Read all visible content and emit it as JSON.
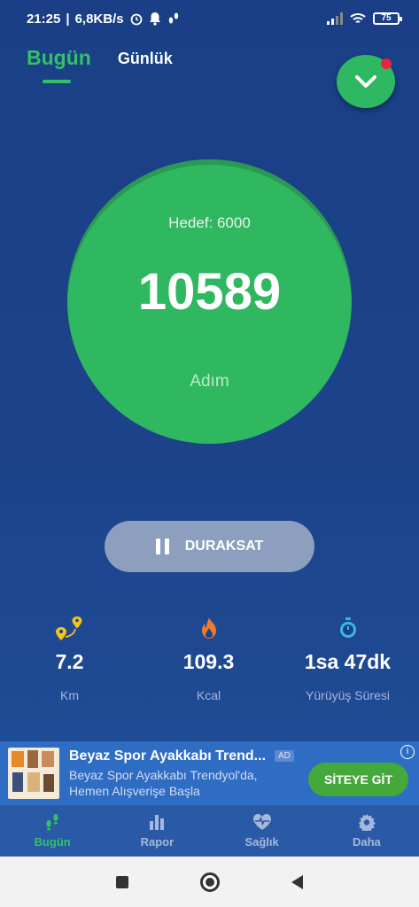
{
  "status": {
    "time": "21:25",
    "network_speed": "6,8KB/s",
    "battery": "75"
  },
  "tabs": [
    {
      "label": "Bugün",
      "active": true
    },
    {
      "label": "Günlük",
      "active": false
    }
  ],
  "steps_panel": {
    "goal": "Hedef: 6000",
    "count": "10589",
    "unit": "Adım"
  },
  "pause_button": {
    "label": "DURAKSAT"
  },
  "stats": [
    {
      "icon": "location-pins-icon",
      "value": "7.2",
      "label": "Km"
    },
    {
      "icon": "flame-icon",
      "value": "109.3",
      "label": "Kcal"
    },
    {
      "icon": "stopwatch-icon",
      "value": "1sa 47dk",
      "label": "Yürüyüş Süresi"
    }
  ],
  "ad": {
    "title": "Beyaz Spor Ayakkabı Trend...",
    "badge": "AD",
    "description": "Beyaz Spor Ayakkabı Trendyol'da, Hemen Alışverişe Başla",
    "cta": "SİTEYE GİT",
    "info": "i"
  },
  "bottom_nav": [
    {
      "icon": "footsteps-icon",
      "label": "Bugün",
      "active": true
    },
    {
      "icon": "bar-chart-icon",
      "label": "Rapor",
      "active": false
    },
    {
      "icon": "heart-pulse-icon",
      "label": "Sağlık",
      "active": false
    },
    {
      "icon": "gear-icon",
      "label": "Daha",
      "active": false
    }
  ],
  "colors": {
    "accent_green": "#2fb860",
    "background_blue": "#1c438a",
    "notification_red": "#e8243c"
  }
}
